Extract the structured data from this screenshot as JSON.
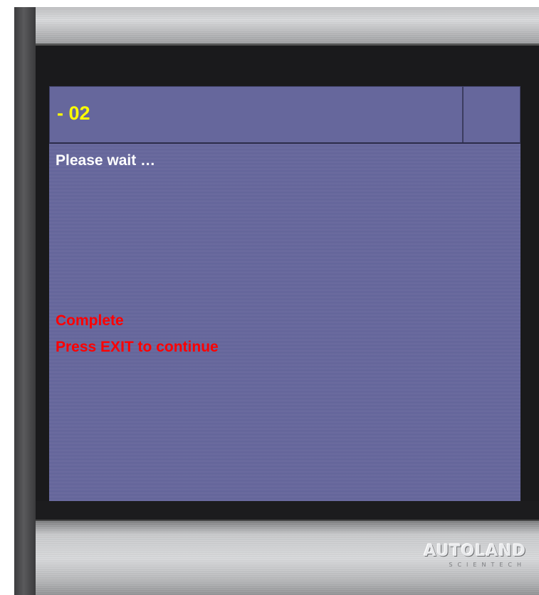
{
  "screen": {
    "title": "- 02",
    "lines": {
      "status": "Please wait …",
      "complete": "Complete",
      "instruction": "Press EXIT to continue"
    }
  },
  "logo": {
    "main": "AUTOLAND",
    "sub": "SCIENTECH"
  },
  "colors": {
    "screen_bg": "#66679c",
    "title_text": "#ffff00",
    "status_text": "#ffffff",
    "alert_text": "#ff0000"
  }
}
